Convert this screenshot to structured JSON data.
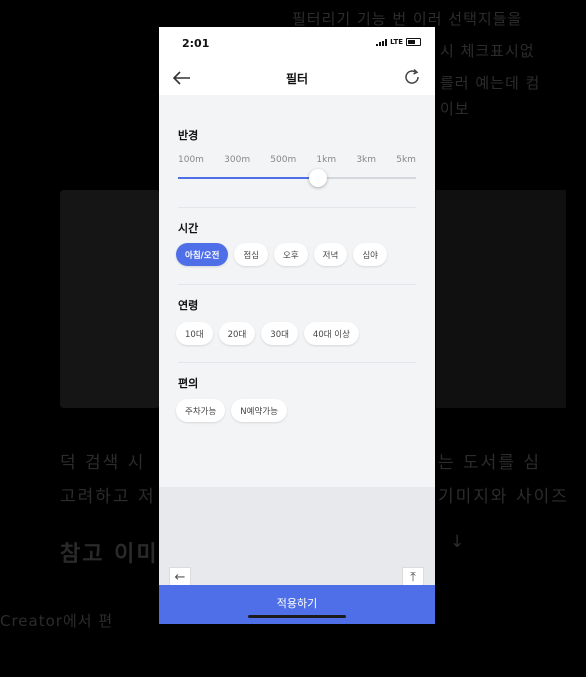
{
  "status_bar": {
    "time": "2:01",
    "network": "LTE"
  },
  "nav": {
    "title": "필터"
  },
  "radius": {
    "title": "반경",
    "options": [
      "100m",
      "300m",
      "500m",
      "1km",
      "3km",
      "5km"
    ],
    "selected_fraction": 0.59
  },
  "time_section": {
    "title": "시간",
    "chips": [
      "아침/오전",
      "점심",
      "오후",
      "저녁",
      "심야"
    ],
    "selected": "아침/오전"
  },
  "age_section": {
    "title": "연령",
    "chips": [
      "10대",
      "20대",
      "30대",
      "40대 이상"
    ]
  },
  "convenience_section": {
    "title": "편의",
    "chips": [
      "주차가능",
      "N예약가능"
    ]
  },
  "apply_button": {
    "label": "적용하기"
  },
  "colors": {
    "accent": "#4f6fe8",
    "panel_background": "#f2f4f6"
  },
  "icons": [
    "back-arrow-icon",
    "refresh-icon",
    "scroll-top-icon"
  ]
}
